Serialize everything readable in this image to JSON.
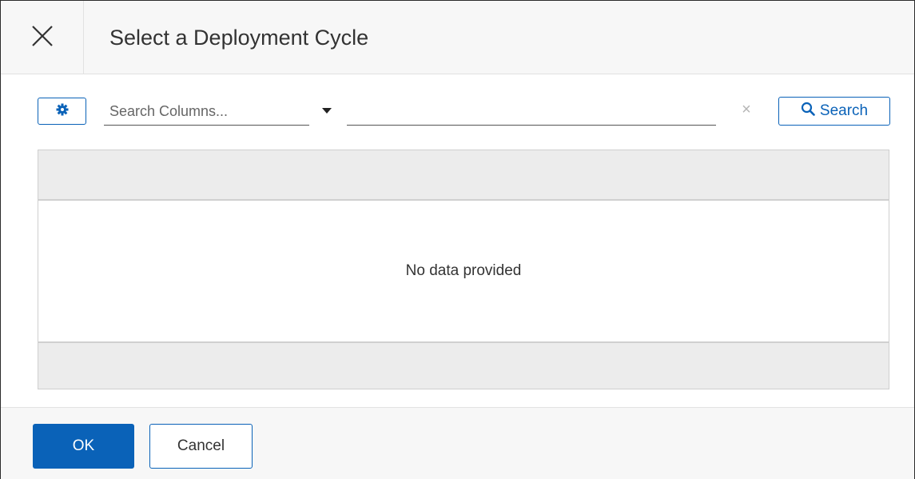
{
  "dialog": {
    "title": "Select a Deployment Cycle",
    "close_icon": "close-icon"
  },
  "toolbar": {
    "settings_icon": "gear-icon",
    "column_placeholder": "Search Columns...",
    "column_dropdown_icon": "caret-down-icon",
    "search_value": "",
    "clear_label": "×",
    "search_icon": "search-icon",
    "search_label": "Search"
  },
  "table": {
    "empty_message": "No data provided"
  },
  "footer": {
    "ok_label": "OK",
    "cancel_label": "Cancel"
  },
  "colors": {
    "accent": "#0a62b8",
    "header_bg": "#f7f7f7",
    "table_band": "#ececec"
  }
}
